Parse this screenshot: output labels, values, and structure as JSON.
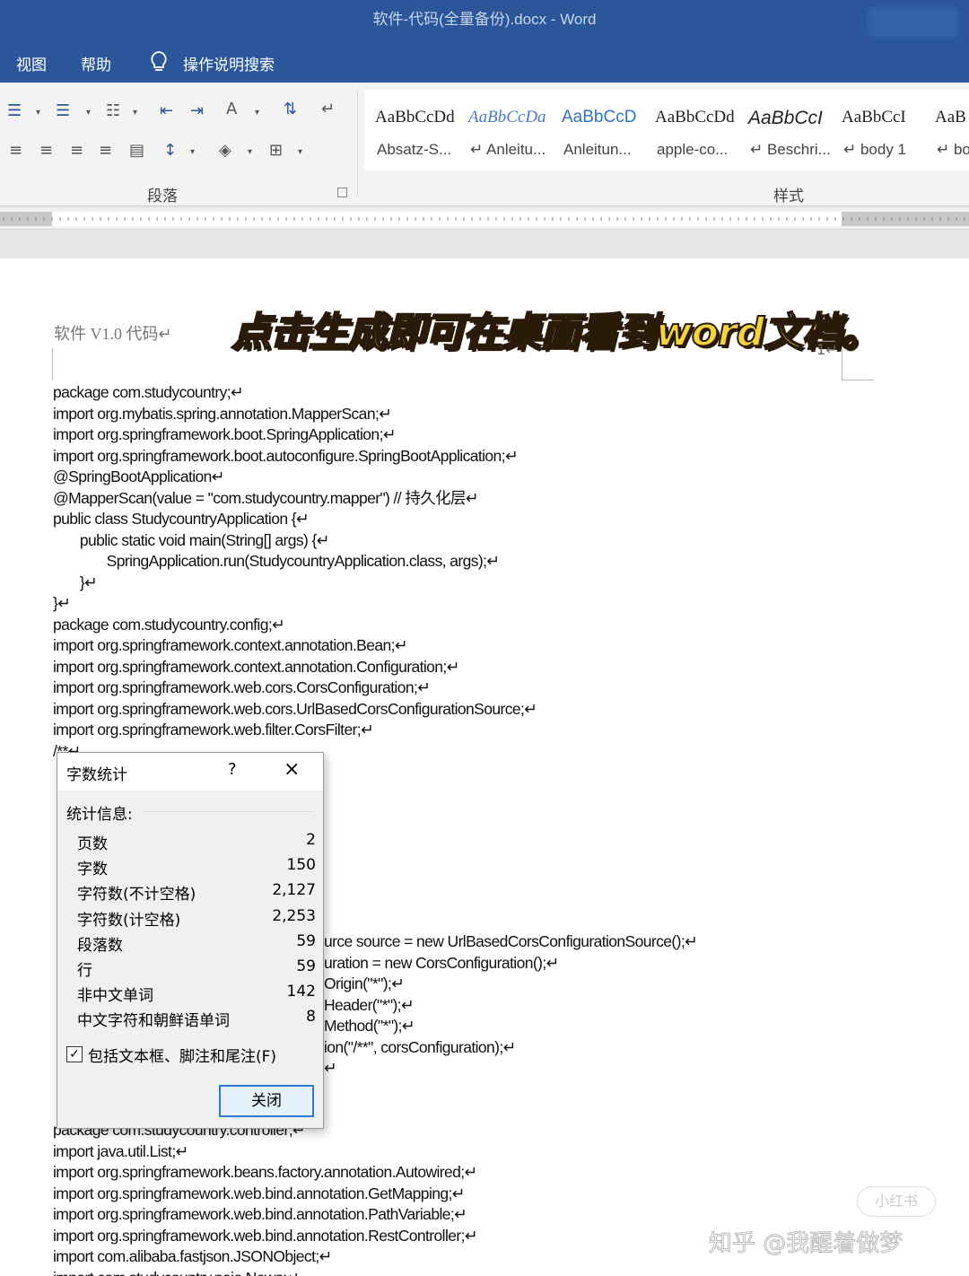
{
  "window": {
    "title": "软件-代码(全量备份).docx  -  Word"
  },
  "menu": [
    "视图",
    "帮助",
    "操作说明搜索"
  ],
  "ribbon": {
    "paragraph_label": "段落",
    "styles_label": "样式",
    "styles": [
      {
        "preview": "AaBbCcDd",
        "name": "Absatz-S..."
      },
      {
        "preview": "AaBbCcDa",
        "name": "↵ Anleitu..."
      },
      {
        "preview": "AaBbCcD",
        "name": "Anleitun..."
      },
      {
        "preview": "AaBbCcDd",
        "name": "apple-co..."
      },
      {
        "preview": "AaBbCcI",
        "name": "↵ Beschri..."
      },
      {
        "preview": "AaBbCcI",
        "name": "↵ body 1"
      },
      {
        "preview": "AaB",
        "name": "↵ bo"
      }
    ]
  },
  "document": {
    "header": "软件 V1.0   代码↵",
    "overlay": "点击生成即可在桌面看到word文档。",
    "page_number": "1↵",
    "lines": [
      "package com.studycountry;↵",
      "import org.mybatis.spring.annotation.MapperScan;↵",
      "import org.springframework.boot.SpringApplication;↵",
      "import org.springframework.boot.autoconfigure.SpringBootApplication;↵",
      "@SpringBootApplication↵",
      "@MapperScan(value = \"com.studycountry.mapper\") // 持久化层↵",
      "public class StudycountryApplication {↵",
      "       public static void main(String[] args) {↵",
      "              SpringApplication.run(StudycountryApplication.class, args);↵",
      "       }↵",
      "}↵",
      "package com.studycountry.config;↵",
      "import org.springframework.context.annotation.Bean;↵",
      "import org.springframework.context.annotation.Configuration;↵",
      "import org.springframework.web.cors.CorsConfiguration;↵",
      "import org.springframework.web.cors.UrlBasedCorsConfigurationSource;↵",
      "import org.springframework.web.filter.CorsFilter;↵",
      "/**↵"
    ],
    "partial_lines": [
      "urce source = new UrlBasedCorsConfigurationSource();↵",
      "uration = new CorsConfiguration();↵",
      "Origin(\"*\");↵",
      "Header(\"*\");↵",
      "Method(\"*\");↵",
      "ion(\"/**\", corsConfiguration);↵",
      "↵"
    ],
    "lines_after": [
      "package com.studycountry.controller;↵",
      "import java.util.List;↵",
      "import org.springframework.beans.factory.annotation.Autowired;↵",
      "import org.springframework.web.bind.annotation.GetMapping;↵",
      "import org.springframework.web.bind.annotation.PathVariable;↵",
      "import org.springframework.web.bind.annotation.RestController;↵",
      "import com.alibaba.fastjson.JSONObject;↵",
      "import com.studycountry.pojo.News;↵"
    ]
  },
  "dialog": {
    "title": "字数统计",
    "help": "?",
    "close_icon": "×",
    "section": "统计信息:",
    "stats": [
      {
        "label": "页数",
        "value": "2"
      },
      {
        "label": "字数",
        "value": "150"
      },
      {
        "label": "字符数(不计空格)",
        "value": "2,127"
      },
      {
        "label": "字符数(计空格)",
        "value": "2,253"
      },
      {
        "label": "段落数",
        "value": "59"
      },
      {
        "label": "行",
        "value": "59"
      },
      {
        "label": "非中文单词",
        "value": "142"
      },
      {
        "label": "中文字符和朝鲜语单词",
        "value": "8"
      }
    ],
    "checkbox_label": "包括文本框、脚注和尾注(F)",
    "checkbox_checked": true,
    "close_button": "关闭"
  },
  "watermark": {
    "text": "知乎 @我醒着做梦",
    "badge": "小红书"
  },
  "colors": {
    "titlebar": "#2b579a",
    "ribbon": "#f3f3f3",
    "overlay_text": "#f5d33a"
  }
}
